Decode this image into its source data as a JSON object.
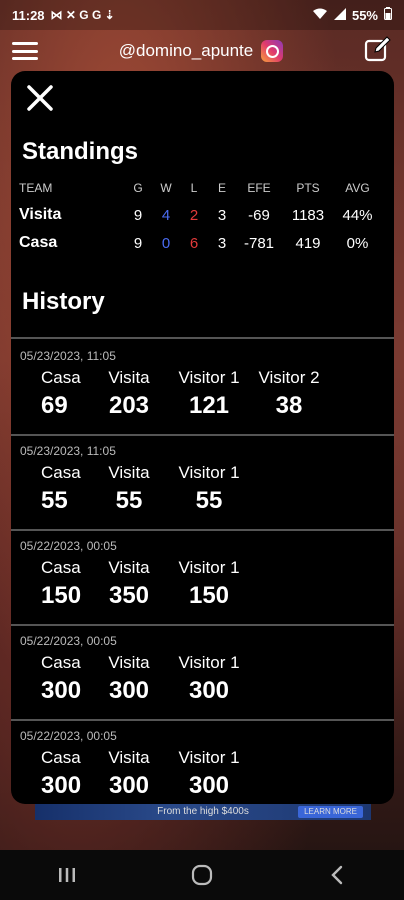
{
  "status_bar": {
    "time": "11:28",
    "notif_icons": "⋈ ✕ G G ⇣",
    "battery": "55%"
  },
  "header": {
    "handle": "@domino_apunte"
  },
  "standings": {
    "title": "Standings",
    "columns": [
      "TEAM",
      "G",
      "W",
      "L",
      "E",
      "EFE",
      "PTS",
      "AVG"
    ],
    "rows": [
      {
        "team": "Visita",
        "g": "9",
        "w": "4",
        "l": "2",
        "e": "3",
        "efe": "-69",
        "pts": "1183",
        "avg": "44%"
      },
      {
        "team": "Casa",
        "g": "9",
        "w": "0",
        "l": "6",
        "e": "3",
        "efe": "-781",
        "pts": "419",
        "avg": "0%"
      }
    ]
  },
  "history": {
    "title": "History",
    "games": [
      {
        "date": "05/23/2023, 11:05",
        "players": [
          {
            "name": "Casa",
            "score": "69"
          },
          {
            "name": "Visita",
            "score": "203"
          },
          {
            "name": "Visitor 1",
            "score": "121"
          },
          {
            "name": "Visitor 2",
            "score": "38"
          }
        ]
      },
      {
        "date": "05/23/2023, 11:05",
        "players": [
          {
            "name": "Casa",
            "score": "55"
          },
          {
            "name": "Visita",
            "score": "55"
          },
          {
            "name": "Visitor 1",
            "score": "55"
          }
        ]
      },
      {
        "date": "05/22/2023, 00:05",
        "players": [
          {
            "name": "Casa",
            "score": "150"
          },
          {
            "name": "Visita",
            "score": "350"
          },
          {
            "name": "Visitor 1",
            "score": "150"
          }
        ]
      },
      {
        "date": "05/22/2023, 00:05",
        "players": [
          {
            "name": "Casa",
            "score": "300"
          },
          {
            "name": "Visita",
            "score": "300"
          },
          {
            "name": "Visitor 1",
            "score": "300"
          }
        ]
      },
      {
        "date": "05/22/2023, 00:05",
        "players": [
          {
            "name": "Casa",
            "score": "300"
          },
          {
            "name": "Visita",
            "score": "300"
          },
          {
            "name": "Visitor 1",
            "score": "300"
          }
        ]
      }
    ]
  },
  "ad_banner": {
    "text": "From the high $400s",
    "button": "LEARN MORE"
  },
  "colors": {
    "wins": "#4a6cf2",
    "losses": "#e23a3a",
    "modal_bg": "#000000"
  }
}
